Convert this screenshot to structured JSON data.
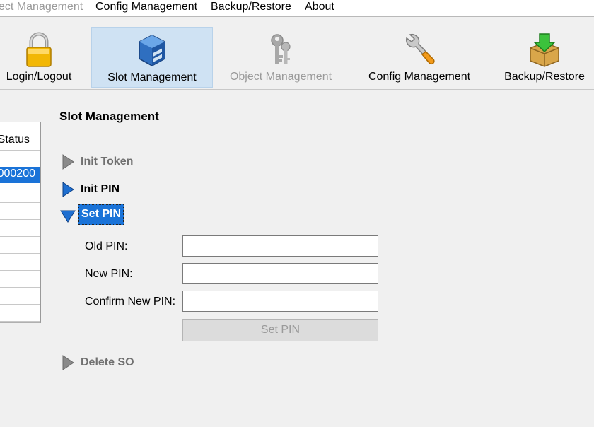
{
  "menu": {
    "items": [
      {
        "label": "ect Management",
        "disabled": true
      },
      {
        "label": "Config Management",
        "disabled": false
      },
      {
        "label": "Backup/Restore",
        "disabled": false
      },
      {
        "label": "About",
        "disabled": false
      }
    ]
  },
  "toolbar": {
    "buttons": [
      {
        "label": "Login/Logout",
        "icon": "padlock-icon"
      },
      {
        "label": "Slot Management",
        "icon": "slot-box-icon",
        "active": true
      },
      {
        "label": "Object Management",
        "icon": "keys-icon",
        "disabled": true
      },
      {
        "label": "Config Management",
        "icon": "wrench-icon"
      },
      {
        "label": "Backup/Restore",
        "icon": "package-download-icon"
      }
    ]
  },
  "slot_table": {
    "header": "Status",
    "rows": [
      "000200",
      "",
      "",
      "",
      "",
      "",
      "",
      "",
      ""
    ]
  },
  "main": {
    "title": "Slot Management",
    "sections": [
      {
        "label": "Init Token",
        "state": "disabled"
      },
      {
        "label": "Init PIN",
        "state": "enabled"
      },
      {
        "label": "Set PIN",
        "state": "expanded"
      },
      {
        "label": "Delete SO",
        "state": "disabled"
      }
    ],
    "set_pin_form": {
      "old_pin_label": "Old PIN:",
      "old_pin_value": "",
      "new_pin_label": "New PIN:",
      "new_pin_value": "",
      "confirm_pin_label": "Confirm New PIN:",
      "confirm_pin_value": "",
      "submit_label": "Set PIN"
    }
  },
  "colors": {
    "selection": "#1a73d8",
    "active_tool": "#cfe2f3",
    "arrow_blue": "#1f6fd0",
    "arrow_gray": "#8a8a8a"
  }
}
